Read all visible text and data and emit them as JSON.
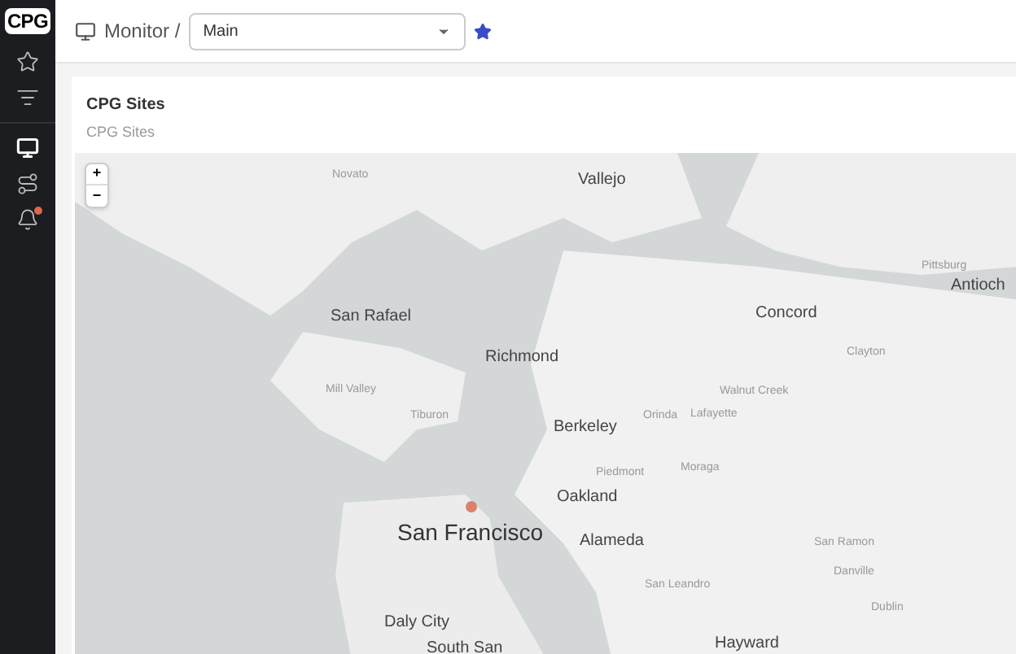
{
  "sidebar": {
    "logo": "CPG",
    "items": [
      {
        "selected": false
      },
      {
        "selected": false
      },
      {
        "selected": true
      },
      {
        "selected": false
      },
      {
        "selected": false,
        "badge": true
      }
    ]
  },
  "header": {
    "breadcrumb": "Monitor /",
    "dashboard": {
      "value": "Main"
    },
    "favorite": true
  },
  "panel": {
    "title": "CPG Sites",
    "subtitle": "CPG Sites",
    "map": {
      "zoom_in": "+",
      "zoom_out": "−",
      "labels": [
        {
          "text": "Novato",
          "kind": "minor"
        },
        {
          "text": "Vallejo",
          "kind": "city"
        },
        {
          "text": "Pittsburg",
          "kind": "minor"
        },
        {
          "text": "Antioch",
          "kind": "city"
        },
        {
          "text": "San Rafael",
          "kind": "city"
        },
        {
          "text": "Concord",
          "kind": "city"
        },
        {
          "text": "Richmond",
          "kind": "city"
        },
        {
          "text": "Clayton",
          "kind": "minor"
        },
        {
          "text": "Mill Valley",
          "kind": "minor"
        },
        {
          "text": "Walnut Creek",
          "kind": "minor"
        },
        {
          "text": "Tiburon",
          "kind": "minor"
        },
        {
          "text": "Berkeley",
          "kind": "city"
        },
        {
          "text": "Orinda",
          "kind": "minor"
        },
        {
          "text": "Lafayette",
          "kind": "minor"
        },
        {
          "text": "Moraga",
          "kind": "minor"
        },
        {
          "text": "Piedmont",
          "kind": "minor"
        },
        {
          "text": "Oakland",
          "kind": "city"
        },
        {
          "text": "San Francisco",
          "kind": "major"
        },
        {
          "text": "Alameda",
          "kind": "city"
        },
        {
          "text": "San Ramon",
          "kind": "minor"
        },
        {
          "text": "Danville",
          "kind": "minor"
        },
        {
          "text": "San Leandro",
          "kind": "minor"
        },
        {
          "text": "Daly City",
          "kind": "city"
        },
        {
          "text": "Dublin",
          "kind": "minor"
        },
        {
          "text": "Hayward",
          "kind": "city"
        },
        {
          "text": "South San",
          "kind": "city"
        }
      ],
      "sites": [
        {
          "color": "#d9826a"
        }
      ]
    }
  }
}
